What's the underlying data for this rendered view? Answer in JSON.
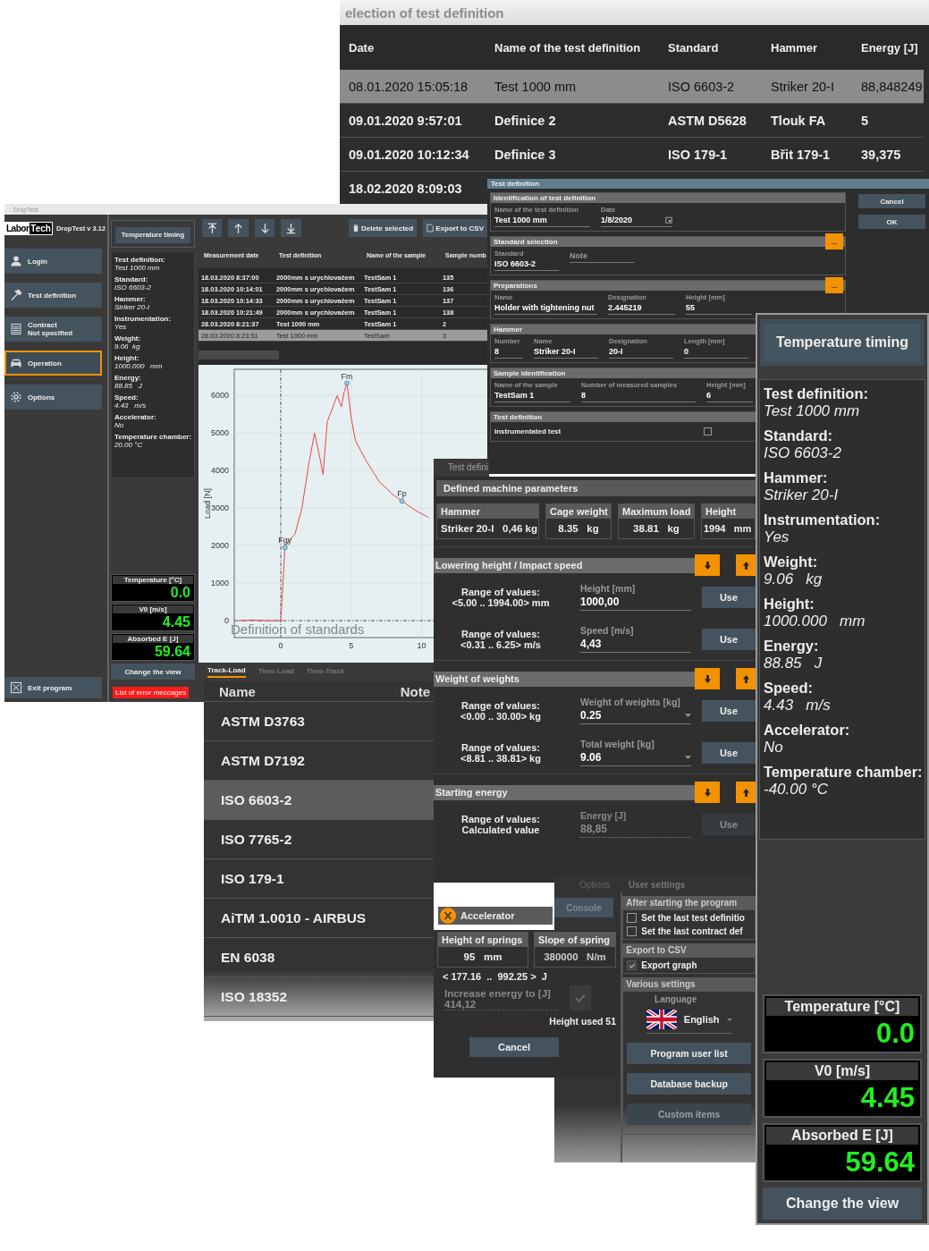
{
  "selection_window": {
    "title": "election of test definition",
    "columns": [
      "Date",
      "Name of the test definition",
      "Standard",
      "Hammer",
      "Energy [J]"
    ],
    "rows": [
      {
        "cells": [
          "08.01.2020 15:05:18",
          "Test 1000 mm",
          "ISO 6603-2",
          "Striker 20-I",
          "88,848249"
        ],
        "selected": true
      },
      {
        "cells": [
          "09.01.2020 9:57:01",
          "Definice 2",
          "ASTM D5628",
          "Tlouk FA",
          "5"
        ],
        "selected": false
      },
      {
        "cells": [
          "09.01.2020 10:12:34",
          "Definice 3",
          "ISO 179-1",
          "Břit 179-1",
          "39,375"
        ],
        "selected": false
      },
      {
        "cells": [
          "18.02.2020 8:09:03"
        ],
        "selected": false
      }
    ]
  },
  "main_app": {
    "title": "DropTest",
    "logo": [
      "Labor",
      "Tech"
    ],
    "version": "DropTest v 3.12",
    "nav": [
      {
        "label": "Login",
        "selected": false
      },
      {
        "label": "Test definition",
        "selected": false
      },
      {
        "label": "Contract",
        "sublabel": "Not specified",
        "selected": false
      },
      {
        "label": "Operation",
        "selected": true
      },
      {
        "label": "Options",
        "selected": false
      }
    ],
    "exit_button": "Exit program",
    "temperature_timing": "Temperature timing",
    "info": [
      {
        "label": "Test definition:",
        "value": "Test 1000 mm"
      },
      {
        "label": "Standard:",
        "value": "ISO 6603-2"
      },
      {
        "label": "Hammer:",
        "value": "Striker 20-I"
      },
      {
        "label": "Instrumentation:",
        "value": "Yes"
      },
      {
        "label": "Weight:",
        "value": "9.06  kg"
      },
      {
        "label": "Height:",
        "value": "1000.000   mm"
      },
      {
        "label": "Energy:",
        "value": "88.85   J"
      },
      {
        "label": "Speed:",
        "value": "4.43   m/s"
      },
      {
        "label": "Accelerator:",
        "value": "No"
      },
      {
        "label": "Temperature chamber:",
        "value": "20.00 °C"
      }
    ],
    "readings": [
      {
        "label": "Temperature [°C]",
        "value": "0.0"
      },
      {
        "label": "V0 [m/s]",
        "value": "4.45"
      },
      {
        "label": "Absorbed E [J]",
        "value": "59.64"
      }
    ],
    "change_view": "Change the view",
    "error_list": "List of error meccages",
    "toolbar": {
      "buttons": [
        "Delete selected",
        "Export to CSV"
      ]
    },
    "table": {
      "columns": [
        "Measurement date",
        "Test definition",
        "Name of the sample",
        "Sample numb"
      ],
      "rows": [
        {
          "cells": [
            "18.03.2020 8:37:00",
            "2000mm s urychlovačem",
            "TestSam 1",
            "135"
          ],
          "selected": false
        },
        {
          "cells": [
            "18.03.2020 10:14:01",
            "2000mm s urychlovačem",
            "TestSam 1",
            "136"
          ],
          "selected": false
        },
        {
          "cells": [
            "18.03.2020 10:14:33",
            "2000mm s urychlovačem",
            "TestSam 1",
            "137"
          ],
          "selected": false
        },
        {
          "cells": [
            "18.03.2020 10:21:49",
            "2000mm s urychlovačem",
            "TestSam 1",
            "138"
          ],
          "selected": false
        },
        {
          "cells": [
            "28.03.2020 8:21:37",
            "Test 1000 mm",
            "TestSam 1",
            "2"
          ],
          "selected": false
        },
        {
          "cells": [
            "28.03.2020 8:23:51",
            "Test 1000 mm",
            "TestSam",
            "3"
          ],
          "selected": true
        }
      ]
    },
    "chart_data": {
      "type": "line",
      "ylabel": "Load [N]",
      "x": [
        -3,
        -2,
        -1,
        0,
        0.3,
        0.6,
        1,
        1.5,
        2,
        2.4,
        2.8,
        3,
        3.3,
        3.6,
        4,
        4.3,
        4.5,
        4.7,
        5,
        5.3,
        6,
        7,
        8,
        8.6,
        9.5,
        10.5
      ],
      "series": [
        {
          "color": "#e84848",
          "values": [
            0,
            20,
            0,
            0,
            1950,
            2150,
            2300,
            3000,
            4200,
            5000,
            4300,
            3900,
            5300,
            5600,
            6000,
            5700,
            6100,
            6330,
            5400,
            4800,
            4300,
            3700,
            3350,
            3190,
            2950,
            2750
          ]
        }
      ],
      "xlim": [
        -3.3,
        15.1
      ],
      "ylim": [
        -450,
        6700
      ],
      "grid": true,
      "xticks": [
        0,
        5,
        10
      ],
      "yticks": [
        0,
        1000,
        2000,
        3000,
        4000,
        5000,
        6000
      ],
      "annotations": [
        {
          "text": "Fm",
          "x": 4.7,
          "y": 6330
        },
        {
          "text": "Fgy",
          "x": 0.3,
          "y": 1950
        },
        {
          "text": "Fp",
          "x": 8.6,
          "y": 3190
        }
      ]
    },
    "tabs": [
      {
        "label": "Track-Load",
        "selected": true
      },
      {
        "label": "Time-Load",
        "selected": false
      },
      {
        "label": "Time-Track",
        "selected": false
      }
    ]
  },
  "standards_window": {
    "title": "Definition of standards",
    "columns": [
      "Name",
      "Note"
    ],
    "rows": [
      {
        "name": "ASTM D3763",
        "selected": false
      },
      {
        "name": "ASTM D7192",
        "selected": false
      },
      {
        "name": "ISO 6603-2",
        "selected": true
      },
      {
        "name": "ISO 7765-2",
        "selected": false
      },
      {
        "name": "ISO 179-1",
        "selected": false
      },
      {
        "name": "AiTM 1.0010 - AIRBUS",
        "selected": false
      },
      {
        "name": "EN 6038",
        "selected": false
      },
      {
        "name": "ISO 18352",
        "selected": false
      }
    ]
  },
  "test_definition_dialog": {
    "title": "Test definition",
    "buttons": [
      "Cancel",
      "OK"
    ],
    "sections": [
      {
        "title": "Identification of test definition",
        "fields": [
          {
            "label": "Name of the test definition",
            "value": "Test 1000 mm",
            "kind": "text"
          },
          {
            "label": "Date",
            "value": "1/8/2020",
            "kind": "date"
          }
        ]
      },
      {
        "title": "Standard selection",
        "more": "...",
        "fields": [
          {
            "label": "Standard",
            "value": "ISO 6603-2",
            "kind": "text"
          },
          {
            "placeholder": "Note",
            "kind": "text"
          }
        ]
      },
      {
        "title": "Preparations",
        "more": "...",
        "fields": [
          {
            "label": "Name",
            "value": "Holder with tightening nut",
            "kind": "text"
          },
          {
            "label": "Designation",
            "value": "2.445219",
            "kind": "text"
          },
          {
            "label": "Height [mm]",
            "value": "55",
            "kind": "text"
          }
        ]
      },
      {
        "title": "Hammer",
        "fields": [
          {
            "label": "Number",
            "value": "8",
            "kind": "text"
          },
          {
            "label": "Name",
            "value": "Striker 20-I",
            "kind": "text"
          },
          {
            "label": "Designation",
            "value": "20-I",
            "kind": "text"
          },
          {
            "label": "Length [mm]",
            "value": "0",
            "kind": "text"
          }
        ]
      },
      {
        "title": "Sample identification",
        "fields": [
          {
            "label": "Name of the sample",
            "value": "TestSam 1",
            "kind": "text"
          },
          {
            "label": "Number of measured samples",
            "value": "8",
            "kind": "text"
          },
          {
            "label": "Height [mm]",
            "value": "6",
            "kind": "text"
          }
        ]
      },
      {
        "title": "Test definition",
        "fields": [
          {
            "label": "Instrumentated test",
            "checked": false,
            "kind": "check"
          }
        ]
      }
    ]
  },
  "machine_dialog": {
    "title": "Test defini",
    "params_title": "Defined machine parameters",
    "params": [
      {
        "label": "Hammer",
        "value": "Striker 20-I",
        "unit": "0,46 kg"
      },
      {
        "label": "Cage weight",
        "value": "8.35",
        "unit": "kg"
      },
      {
        "label": "Maximum load",
        "value": "38.81",
        "unit": "kg"
      },
      {
        "label": "Height",
        "value": "1994",
        "unit": "mm"
      }
    ],
    "sections": [
      {
        "title": "Lowering height / Impact speed",
        "rows": [
          {
            "range_label": "Range of values:",
            "range": "<5.00 .. 1994.00> mm",
            "field_label": "Height [mm]",
            "value": "1000,00",
            "dropdown": false,
            "button": "Use",
            "disabled": false
          },
          {
            "range_label": "Range of values:",
            "range": "<0.31 .. 6.25> m/s",
            "field_label": "Speed [m/s]",
            "value": "4,43",
            "dropdown": false,
            "button": "Use",
            "disabled": false
          }
        ]
      },
      {
        "title": "Weight of weights",
        "rows": [
          {
            "range_label": "Range of values:",
            "range": "<0.00 .. 30.00> kg",
            "field_label": "Weight of weights [kg]",
            "value": "0.25",
            "dropdown": true,
            "button": "Use",
            "disabled": false
          },
          {
            "range_label": "Range of values:",
            "range": "<8.81 .. 38.81> kg",
            "field_label": "Total weight [kg]",
            "value": "9.06",
            "dropdown": true,
            "button": "Use",
            "disabled": false
          }
        ]
      },
      {
        "title": "Starting energy",
        "rows": [
          {
            "range_label": "Range of values:",
            "range": "Calculated value",
            "field_label": "Energy [J]",
            "value": "88,85",
            "dropdown": false,
            "button": "Use",
            "disabled": true
          }
        ]
      }
    ]
  },
  "accelerator": {
    "title": "Accelerator",
    "params": [
      {
        "label": "Height of springs",
        "value": "95",
        "unit": "mm"
      },
      {
        "label": "Slope of spring",
        "value": "380000",
        "unit": "N/m"
      }
    ],
    "range": "< 177.16  ..  992.25 >  J",
    "increase_label": "Increase energy to [J]",
    "increase_value": "414,12",
    "height_used": "Height used 51",
    "cancel": "Cancel"
  },
  "options_window": {
    "tabs": [
      {
        "label": "Options",
        "selected": false
      },
      {
        "label": "User settings",
        "selected": true
      }
    ],
    "console_button": "Console",
    "startup_title": "After starting the program",
    "startup": [
      {
        "label": "Set the last test definitio",
        "checked": false
      },
      {
        "label": "Set the last contract def",
        "checked": false
      }
    ],
    "export_title": "Export to CSV",
    "export": [
      {
        "label": "Export graph",
        "checked": true
      }
    ],
    "various_title": "Various settings",
    "language_label": "Language",
    "language": "English",
    "buttons": [
      {
        "label": "Program user list",
        "disabled": false
      },
      {
        "label": "Database backup",
        "disabled": false
      },
      {
        "label": "Custom items",
        "disabled": true
      }
    ]
  },
  "right_panel": {
    "temperature_timing": "Temperature timing",
    "info": [
      {
        "label": "Test definition:",
        "value": "Test 1000 mm"
      },
      {
        "label": "Standard:",
        "value": "ISO 6603-2"
      },
      {
        "label": "Hammer:",
        "value": "Striker 20-I"
      },
      {
        "label": "Instrumentation:",
        "value": "Yes"
      },
      {
        "label": "Weight:",
        "value": "9.06   kg"
      },
      {
        "label": "Height:",
        "value": "1000.000   mm"
      },
      {
        "label": "Energy:",
        "value": "88.85   J"
      },
      {
        "label": "Speed:",
        "value": "4.43   m/s"
      },
      {
        "label": "Accelerator:",
        "value": "No"
      },
      {
        "label": "Temperature chamber:",
        "value": "-40.00 °C"
      }
    ],
    "readings": [
      {
        "label": "Temperature [°C]",
        "value": "0.0"
      },
      {
        "label": "V0 [m/s]",
        "value": "4.45"
      },
      {
        "label": "Absorbed E [J]",
        "value": "59.64"
      }
    ],
    "change_view": "Change the view"
  }
}
